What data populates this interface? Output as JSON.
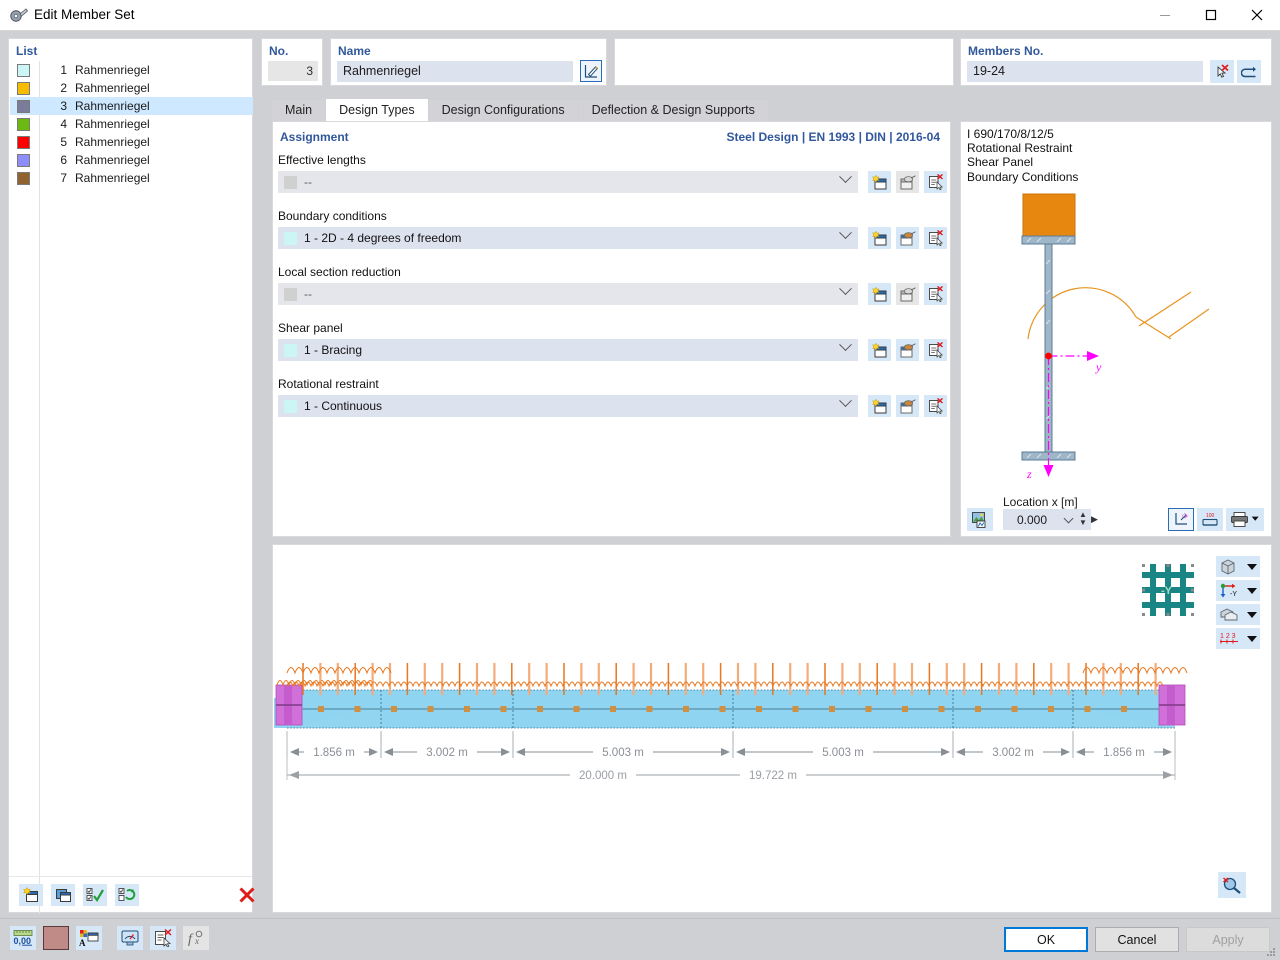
{
  "window": {
    "title": "Edit Member Set",
    "app_icon": "member-set-icon",
    "minimize": "–",
    "maximize": "□",
    "close": "✕"
  },
  "list": {
    "header": "List",
    "items": [
      {
        "num": "1",
        "name": "Rahmenriegel",
        "color": "#ccf5f5"
      },
      {
        "num": "2",
        "name": "Rahmenriegel",
        "color": "#f5bc00"
      },
      {
        "num": "3",
        "name": "Rahmenriegel",
        "color": "#7b7b9c"
      },
      {
        "num": "4",
        "name": "Rahmenriegel",
        "color": "#6cb912"
      },
      {
        "num": "5",
        "name": "Rahmenriegel",
        "color": "#fe0000"
      },
      {
        "num": "6",
        "name": "Rahmenriegel",
        "color": "#8e8efa"
      },
      {
        "num": "7",
        "name": "Rahmenriegel",
        "color": "#916330"
      }
    ],
    "selected_index": 2,
    "toolbar": [
      "new-item-icon",
      "copy-item-icon",
      "check-all-icon",
      "invert-check-icon",
      "delete-icon"
    ]
  },
  "header": {
    "no_label": "No.",
    "no_value": "3",
    "name_label": "Name",
    "name_value": "Rahmenriegel",
    "name_edit_icon": "edit-pencil-icon",
    "members_label": "Members No.",
    "members_value": "19-24",
    "members_pick_icon": "select-pointer-icon",
    "members_undo_icon": "↵"
  },
  "tabs": [
    {
      "label": "Main",
      "active": false
    },
    {
      "label": "Design Types",
      "active": true
    },
    {
      "label": "Design Configurations",
      "active": false
    },
    {
      "label": "Deflection & Design Supports",
      "active": false
    }
  ],
  "content": {
    "assignment_label": "Assignment",
    "standard_label": "Steel Design | EN 1993 | DIN | 2016-04",
    "fields": [
      {
        "label": "Effective lengths",
        "value": "--",
        "swatch": "#d0d0d0",
        "disabled": true,
        "buttons": [
          "new-icon",
          "edit-icon",
          "delete-icon"
        ],
        "edit_disabled": true
      },
      {
        "label": "Boundary conditions",
        "value": "1 - 2D - 4 degrees of freedom",
        "swatch": "#ccf5f5",
        "disabled": false,
        "buttons": [
          "new-icon",
          "edit-icon",
          "delete-icon"
        ],
        "edit_disabled": false
      },
      {
        "label": "Local section reduction",
        "value": "--",
        "swatch": "#d0d0d0",
        "disabled": true,
        "buttons": [
          "new-icon",
          "edit-icon",
          "delete-icon"
        ],
        "edit_disabled": true
      },
      {
        "label": "Shear panel",
        "value": "1 - Bracing",
        "swatch": "#ccf5f5",
        "disabled": false,
        "buttons": [
          "new-icon",
          "edit-icon",
          "delete-icon"
        ],
        "edit_disabled": false
      },
      {
        "label": "Rotational restraint",
        "value": "1 - Continuous",
        "swatch": "#ccf5f5",
        "disabled": false,
        "buttons": [
          "new-icon",
          "edit-icon",
          "delete-icon"
        ],
        "edit_disabled": false
      }
    ]
  },
  "preview": {
    "info_lines": [
      "I 690/170/8/12/5",
      "Rotational Restraint",
      "Shear Panel",
      "Boundary Conditions"
    ],
    "axis_y_label": "y",
    "axis_z_label": "z",
    "location_label": "Location x [m]",
    "location_value": "0.000",
    "image_button_icon": "render-image-icon",
    "buttons": [
      "axis-system-icon",
      "dimensions-icon",
      "print-icon"
    ],
    "colors": {
      "section": "#8aa8bf",
      "restraint": "#e08214",
      "axis": "#ff00ff"
    }
  },
  "graphic": {
    "viewcube_label": "-Y",
    "view_buttons": [
      "render-mode-icon",
      "axis-view-icon",
      "section-view-icon",
      "numbering-icon"
    ],
    "zoom_button_icon": "zoom-find-icon",
    "dimensions": {
      "segments": [
        "1.856 m",
        "3.002 m",
        "5.003 m",
        "5.003 m",
        "3.002 m",
        "1.856 m"
      ],
      "totals": [
        "20.000 m",
        "19.722 m"
      ]
    },
    "colors": {
      "member": "#8fd4f0",
      "support": "#d070d8",
      "load": "#e8771f"
    }
  },
  "statusbar": {
    "tools": [
      "decimal-places-icon",
      "color-swatch-icon",
      "render-settings-icon",
      "display-icon",
      "delete-selection-icon",
      "formula-icon"
    ],
    "ok_label": "OK",
    "cancel_label": "Cancel",
    "apply_label": "Apply"
  }
}
